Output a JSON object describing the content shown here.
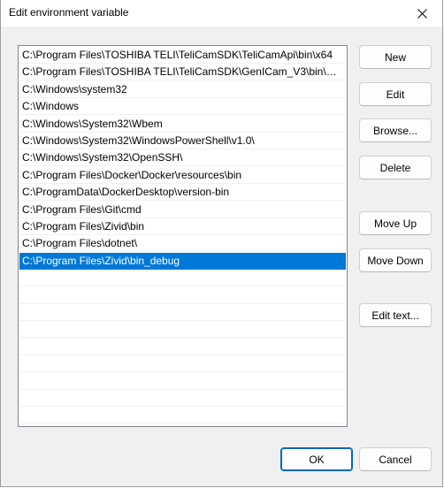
{
  "window": {
    "title": "Edit environment variable",
    "close_icon": "close-icon"
  },
  "paths": [
    "C:\\Program Files\\TOSHIBA TELI\\TeliCamSDK\\TeliCamApi\\bin\\x64",
    "C:\\Program Files\\TOSHIBA TELI\\TeliCamSDK\\GenICam_V3\\bin\\Win6...",
    "C:\\Windows\\system32",
    "C:\\Windows",
    "C:\\Windows\\System32\\Wbem",
    "C:\\Windows\\System32\\WindowsPowerShell\\v1.0\\",
    "C:\\Windows\\System32\\OpenSSH\\",
    "C:\\Program Files\\Docker\\Docker\\resources\\bin",
    "C:\\ProgramData\\DockerDesktop\\version-bin",
    "C:\\Program Files\\Git\\cmd",
    "C:\\Program Files\\Zivid\\bin",
    "C:\\Program Files\\dotnet\\",
    "C:\\Program Files\\Zivid\\bin_debug"
  ],
  "selected_index": 12,
  "buttons": {
    "new": "New",
    "edit": "Edit",
    "browse": "Browse...",
    "delete": "Delete",
    "move_up": "Move Up",
    "move_down": "Move Down",
    "edit_text": "Edit text...",
    "ok": "OK",
    "cancel": "Cancel"
  },
  "colors": {
    "selection": "#0078d7",
    "accent": "#0067c0"
  }
}
